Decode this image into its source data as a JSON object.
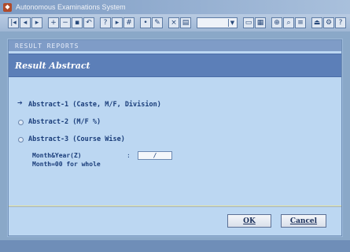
{
  "window": {
    "title": "Autonomous Examinations System"
  },
  "panel": {
    "header": "RESULT REPORTS",
    "title": "Result Abstract"
  },
  "options": [
    {
      "label": "Abstract-1 (Caste, M/F, Division)",
      "selected": true
    },
    {
      "label": "Abstract-2 (M/F %)",
      "selected": false
    },
    {
      "label": "Abstract-3 (Course Wise)",
      "selected": false
    }
  ],
  "fields": {
    "month_year_label": "Month&Year(Z)",
    "month_year_colon": ":",
    "month_year_value": "/",
    "month_note": "Month=00 for whole"
  },
  "buttons": {
    "ok": "OK",
    "cancel": "Cancel"
  }
}
